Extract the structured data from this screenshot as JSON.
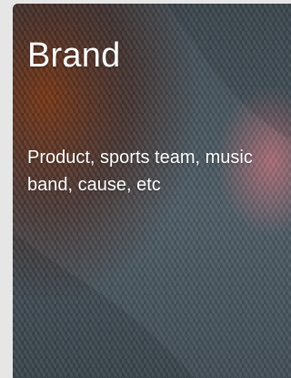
{
  "card": {
    "title": "Brand",
    "description": "Product, sports team, music band, cause, etc",
    "background_image": "knitted-sweater-photo",
    "colors": {
      "page_background": "#e6e6e6",
      "knit_gray_blue": "#4f5e68",
      "accent_rust": "#8a3a12",
      "accent_pink": "#d97a84",
      "text": "#ffffff"
    }
  }
}
